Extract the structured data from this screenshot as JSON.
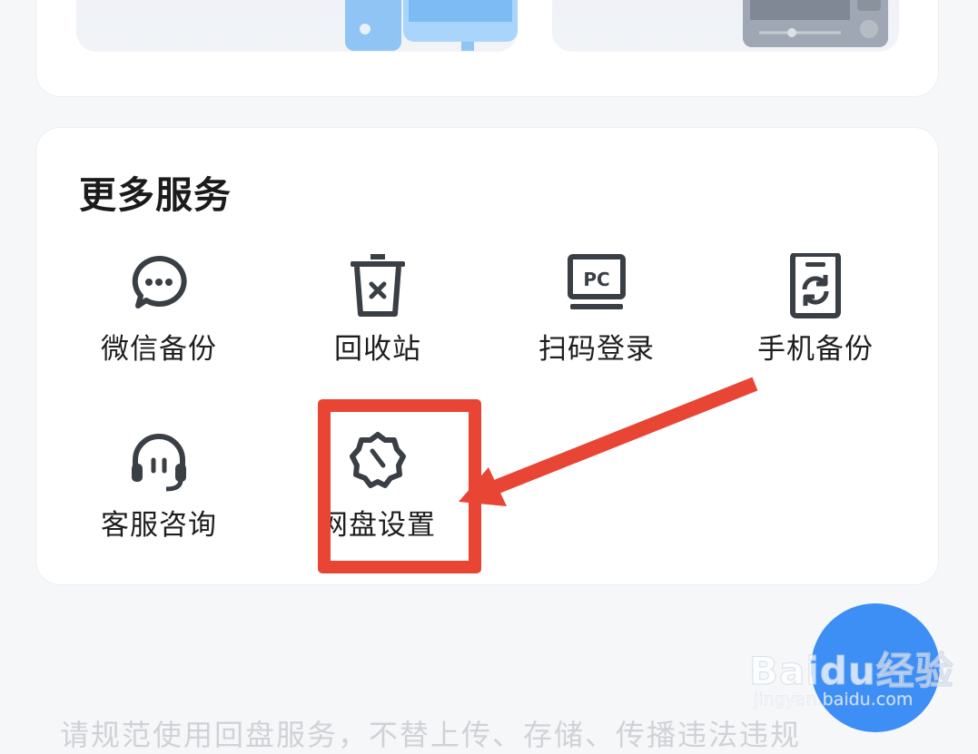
{
  "more_services": {
    "title": "更多服务",
    "items": [
      {
        "label": "微信备份",
        "icon": "wechat-icon"
      },
      {
        "label": "回收站",
        "icon": "trash-icon"
      },
      {
        "label": "扫码登录",
        "icon": "pc-monitor-icon"
      },
      {
        "label": "手机备份",
        "icon": "phone-backup-icon"
      },
      {
        "label": "客服咨询",
        "icon": "headset-icon"
      },
      {
        "label": "网盘设置",
        "icon": "settings-gear-icon"
      }
    ]
  },
  "bottom_text": "请规范使用回盘服务，不替上传、存储、传播违法违规",
  "watermark": {
    "main": "Baidu经验",
    "sub": "jingyan.baidu.com"
  },
  "colors": {
    "highlight": "#e84535",
    "fab": "#3d8ef5",
    "icon": "#3a3f45"
  }
}
